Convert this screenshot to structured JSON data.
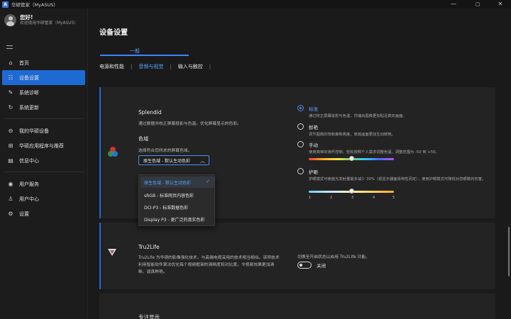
{
  "window": {
    "logo_text": "A",
    "title": "华硕管家（MyASUS）",
    "min_glyph": "—",
    "max_glyph": "▢",
    "close_glyph": "✕"
  },
  "profile": {
    "greeting": "您好!",
    "welcome": "欢迎使用华硕管家（MyASUS）"
  },
  "sidebar": {
    "items": [
      {
        "label": "首页",
        "icon": "home-icon",
        "glyph": "⌂"
      },
      {
        "label": "设备设置",
        "icon": "settings-sliders-icon",
        "glyph": "☷",
        "active": true
      },
      {
        "label": "系统诊断",
        "icon": "diagnosis-icon",
        "glyph": "✎"
      },
      {
        "label": "系统更新",
        "icon": "refresh-icon",
        "glyph": "↻"
      },
      {
        "label": "我的华硕设备",
        "icon": "devices-icon",
        "glyph": "⊖"
      },
      {
        "label": "华硕应用程序与推荐",
        "icon": "apps-icon",
        "glyph": "⊞"
      },
      {
        "label": "信息中心",
        "icon": "message-icon",
        "glyph": "▤"
      },
      {
        "label": "用户服务",
        "icon": "location-icon",
        "glyph": "◉"
      },
      {
        "label": "用户中心",
        "icon": "user-icon",
        "glyph": "♙"
      },
      {
        "label": "设置",
        "icon": "gear-icon",
        "glyph": "⚙"
      }
    ]
  },
  "main": {
    "title": "设备设置",
    "group_tab": "一般",
    "tabs": [
      {
        "label": "电源和性能"
      },
      {
        "label": "音频与视觉",
        "active": true
      },
      {
        "label": "输入与触控"
      }
    ],
    "tab_separator": "|"
  },
  "splendid": {
    "title": "Splendid",
    "desc": "通过数据并校正屏幕投影与色温，优化屏幕显示的色彩。",
    "gamut_title": "色域",
    "gamut_desc": "选择符合您所求的屏幕色域。",
    "gamut_selected": "原生色域 - 默认生动色彩",
    "caret": "︿",
    "gamut_options": [
      {
        "label": "原生色域 - 默认生动色彩",
        "selected": true
      },
      {
        "label": "sRGB - 标准网页内容色彩"
      },
      {
        "label": "DCI-P3 - 标准数据色彩"
      },
      {
        "label": "Display P3 - 更广泛的真实色彩"
      }
    ],
    "check_glyph": "✓",
    "modes": [
      {
        "label": "标准",
        "desc": "通过校正屏幕投影与色温，优缩出图像更加贴近真实画面。",
        "selected": true
      },
      {
        "label": "鲜艳",
        "desc": "调节图像的饱和度和亮度，使其画面更加生动鲜艳。"
      },
      {
        "label": "手动",
        "desc": "使用简单的滑杆控制，轻松按照个人需求调整色温，调整范围为 -50 到 +50。"
      },
      {
        "label": "护眼",
        "desc": "护眼模式可使蓝光发射量最多减少 30%（视显示器面板特性而定），使用护眼模式可降低对您眼睛的伤害。"
      }
    ],
    "manual_slider_value": 0,
    "manual_slider_range": [
      -50,
      50
    ],
    "eyecare_slider_value": 3,
    "eyecare_ticks": [
      "1",
      "2",
      "3",
      "4",
      "5"
    ]
  },
  "tru2life": {
    "title": "Tru2Life",
    "desc_line1": "Tru2Life 为华硕的影像强化技术，与高端电视采用的技术相当相似。该项技术",
    "desc_line2": "利用智能软件算法优化每个视频框架的清晰度和对比度，令视频效果更加清",
    "desc_line3": "晰、逼真鲜艳。",
    "toggle_desc": "切换至开启状态以启用 Tru2Life 功能。",
    "toggle_label": "关闭",
    "enabled": false
  },
  "focus": {
    "title": "专注显示"
  },
  "colors": {
    "accent": "#1e6ad3",
    "link": "#5aa2ff",
    "background": "#1a1a1a",
    "card": "#232323"
  }
}
